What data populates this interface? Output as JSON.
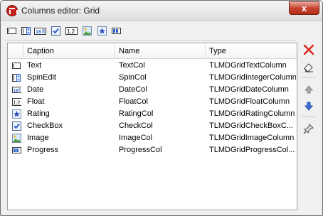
{
  "window": {
    "title": "Columns editor: Grid",
    "close_label": "x"
  },
  "toolbar": {
    "buttons": [
      {
        "name": "text-column-icon"
      },
      {
        "name": "spinedit-column-icon"
      },
      {
        "name": "date-column-icon"
      },
      {
        "name": "checkbox-column-icon"
      },
      {
        "name": "float-column-icon",
        "label": "1,2"
      },
      {
        "name": "image-column-icon"
      },
      {
        "name": "rating-column-icon"
      },
      {
        "name": "progress-column-icon"
      }
    ]
  },
  "grid": {
    "headers": {
      "caption": "Caption",
      "name": "Name",
      "type": "Type"
    },
    "rows": [
      {
        "icon": "text-column-icon",
        "caption": "Text",
        "name": "TextCol",
        "type": "TLMDGridTextColumn"
      },
      {
        "icon": "spinedit-column-icon",
        "caption": "SpinEdit",
        "name": "SpinCol",
        "type": "TLMDGridIntegerColumn"
      },
      {
        "icon": "date-column-icon",
        "caption": "Date",
        "name": "DateCol",
        "type": "TLMDGridDateColumn"
      },
      {
        "icon": "float-column-icon",
        "caption": "Float",
        "name": "FloatCol",
        "type": "TLMDGridFloatColumn"
      },
      {
        "icon": "rating-column-icon",
        "caption": "Rating",
        "name": "RatingCol",
        "type": "TLMDGridRatingColumn"
      },
      {
        "icon": "checkbox-column-icon",
        "caption": "CheckBox",
        "name": "CheckCol",
        "type": "TLMDGridCheckBoxC..."
      },
      {
        "icon": "image-column-icon",
        "caption": "Image",
        "name": "ImageCol",
        "type": "TLMDGridImageColumn"
      },
      {
        "icon": "progress-column-icon",
        "caption": "Progress",
        "name": "ProgressCol",
        "type": "TLMDGridProgressCol..."
      }
    ]
  },
  "sidebar": {
    "buttons": [
      {
        "name": "delete-icon"
      },
      {
        "name": "eraser-icon"
      },
      {
        "name": "move-up-icon"
      },
      {
        "name": "move-down-icon"
      },
      {
        "name": "pin-icon"
      }
    ]
  },
  "colors": {
    "accent_blue": "#2a62c9",
    "delete_red": "#d9261c",
    "close_red": "#c7432f"
  }
}
